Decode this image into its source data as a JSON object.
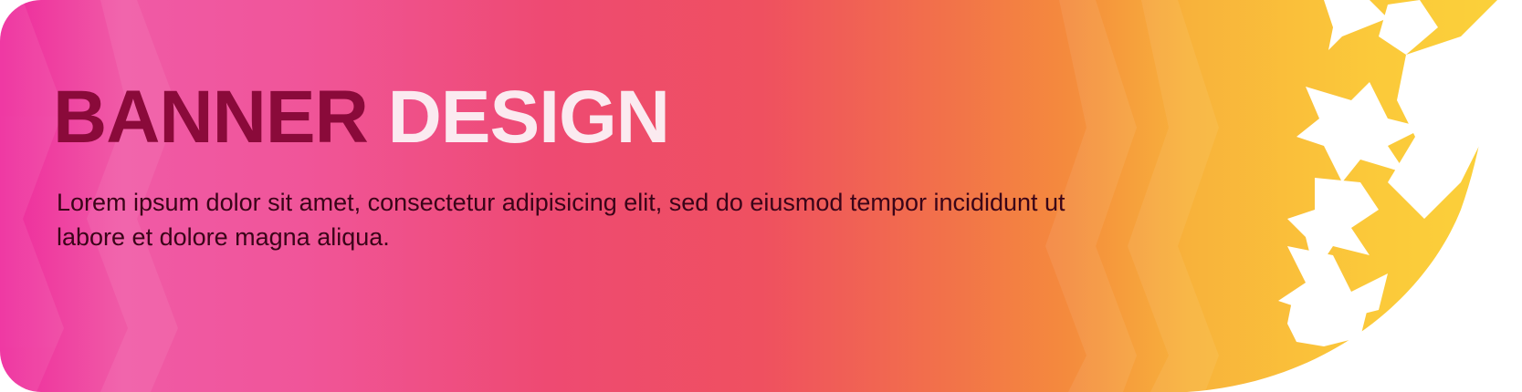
{
  "banner": {
    "title_part1": "BANNER",
    "title_part2": "DESIGN",
    "body": "Lorem ipsum dolor sit amet, consectetur adipisicing elit, sed do eiusmod tempor incididunt ut labore et dolore magna aliqua."
  },
  "colors": {
    "gradient_start": "#ee2a9c",
    "gradient_pink": "#f0509a",
    "gradient_red": "#ef4f62",
    "gradient_orange": "#f3823f",
    "gradient_yellow": "#fbc93a",
    "title_dark": "#8a0a3a",
    "title_light": "#fbeaf0"
  }
}
